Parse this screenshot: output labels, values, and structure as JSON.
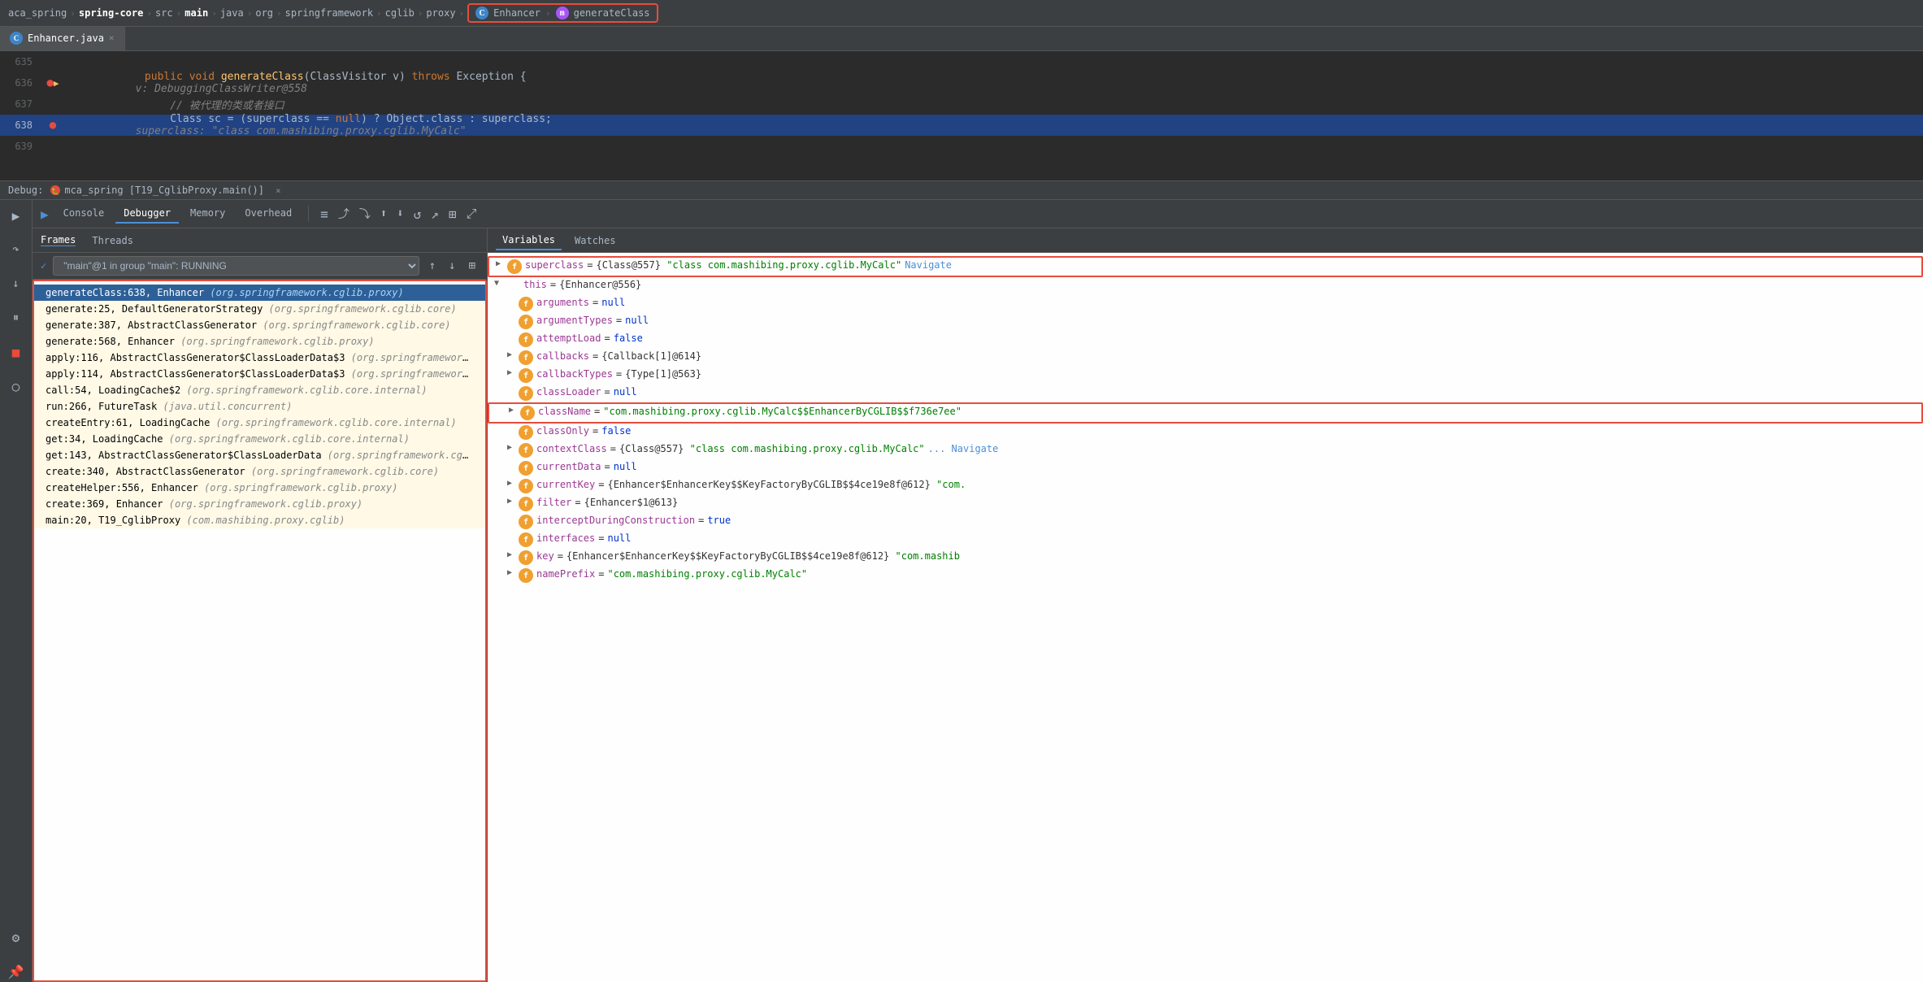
{
  "breadcrumb": {
    "items": [
      "aca_spring",
      "spring-core",
      "src",
      "main",
      "java",
      "org",
      "springframework",
      "cglib",
      "proxy"
    ],
    "highlighted": [
      "Enhancer",
      "generateClass"
    ]
  },
  "tabs": [
    {
      "label": "Enhancer.java",
      "active": true
    }
  ],
  "codeLines": [
    {
      "num": "635",
      "content": "",
      "gutter": ""
    },
    {
      "num": "636",
      "content": "    public void generateClass(ClassVisitor v) throws Exception {",
      "hint": "v: DebuggingClassWriter@558",
      "gutter": "breakpoint,debugarrow"
    },
    {
      "num": "637",
      "content": "        // 被代理的类或者接口",
      "gutter": ""
    },
    {
      "num": "638",
      "content": "        Class sc = (superclass == null) ? Object.class : superclass;",
      "hint": "superclass: \"class com.mashibing.proxy.cglib.MyCalc\"",
      "highlighted": true,
      "gutter": "breakpoint"
    },
    {
      "num": "639",
      "content": "",
      "gutter": ""
    }
  ],
  "debugSession": {
    "label": "Debug:",
    "session": "mca_spring [T19_CglibProxy.main()]"
  },
  "toolbar": {
    "tabs": [
      "Console",
      "Debugger",
      "Memory",
      "Overhead"
    ],
    "activeTab": "Debugger"
  },
  "framesTabs": [
    "Frames",
    "Threads"
  ],
  "activeFramesTab": "Frames",
  "threadSelector": {
    "value": "\"main\"@1 in group \"main\": RUNNING"
  },
  "stackFrames": [
    {
      "method": "generateClass:638, Enhancer",
      "pkg": "(org.springframework.cglib.proxy)",
      "selected": true
    },
    {
      "method": "generate:25, DefaultGeneratorStrategy",
      "pkg": "(org.springframework.cglib.core)",
      "bg": true
    },
    {
      "method": "generate:387, AbstractClassGenerator",
      "pkg": "(org.springframework.cglib.core)",
      "bg": true
    },
    {
      "method": "generate:568, Enhancer",
      "pkg": "(org.springframework.cglib.proxy)",
      "bg": true
    },
    {
      "method": "apply:116, AbstractClassGenerator$ClassLoaderData$3",
      "pkg": "(org.springframework.cglib.",
      "bg": true
    },
    {
      "method": "apply:114, AbstractClassGenerator$ClassLoaderData$3",
      "pkg": "(org.springframework.cglib.",
      "bg": true
    },
    {
      "method": "call:54, LoadingCache$2",
      "pkg": "(org.springframework.cglib.core.internal)",
      "bg": true
    },
    {
      "method": "run:266, FutureTask",
      "pkg": "(java.util.concurrent)",
      "bg": true
    },
    {
      "method": "createEntry:61, LoadingCache",
      "pkg": "(org.springframework.cglib.core.internal)",
      "bg": true
    },
    {
      "method": "get:34, LoadingCache",
      "pkg": "(org.springframework.cglib.core.internal)",
      "bg": true
    },
    {
      "method": "get:143, AbstractClassGenerator$ClassLoaderData",
      "pkg": "(org.springframework.cglib.core",
      "bg": true
    },
    {
      "method": "create:340, AbstractClassGenerator",
      "pkg": "(org.springframework.cglib.core)",
      "bg": true
    },
    {
      "method": "createHelper:556, Enhancer",
      "pkg": "(org.springframework.cglib.proxy)",
      "bg": true
    },
    {
      "method": "create:369, Enhancer",
      "pkg": "(org.springframework.cglib.proxy)",
      "bg": true
    },
    {
      "method": "main:20, T19_CglibProxy",
      "pkg": "(com.mashibing.proxy.cglib)",
      "bg": true
    }
  ],
  "variablesTabs": [
    "Variables",
    "Watches"
  ],
  "activeVarTab": "Variables",
  "variables": [
    {
      "indent": 0,
      "expander": "▶",
      "icon": "f",
      "name": "superclass",
      "eq": "=",
      "val": "{Class@557}",
      "valStr": " \"class com.mashibing.proxy.cglib.MyCalc\"",
      "navigate": "Navigate",
      "highlight": true,
      "superclassRow": true
    },
    {
      "indent": 0,
      "expander": "▼",
      "name": "this",
      "eq": "=",
      "val": "{Enhancer@556}",
      "thisRow": true
    },
    {
      "indent": 1,
      "expander": "",
      "icon": "f",
      "name": "arguments",
      "eq": "=",
      "val": "null"
    },
    {
      "indent": 1,
      "expander": "",
      "icon": "f",
      "name": "argumentTypes",
      "eq": "=",
      "val": "null"
    },
    {
      "indent": 1,
      "expander": "",
      "icon": "f",
      "name": "attemptLoad",
      "eq": "=",
      "val": "false"
    },
    {
      "indent": 1,
      "expander": "▶",
      "icon": "f",
      "name": "callbacks",
      "eq": "=",
      "val": "{Callback[1]@614}"
    },
    {
      "indent": 1,
      "expander": "▶",
      "icon": "f",
      "name": "callbackTypes",
      "eq": "=",
      "val": "{Type[1]@563}"
    },
    {
      "indent": 1,
      "expander": "",
      "icon": "f",
      "name": "classLoader",
      "eq": "=",
      "val": "null"
    },
    {
      "indent": 1,
      "expander": "▶",
      "icon": "f",
      "name": "className",
      "eq": "=",
      "val": "\"com.mashibing.proxy.cglib.MyCalc$$EnhancerByCGLIB$$f736e7ee\"",
      "classNameRow": true
    },
    {
      "indent": 1,
      "expander": "",
      "icon": "f",
      "name": "classOnly",
      "eq": "=",
      "val": "false"
    },
    {
      "indent": 1,
      "expander": "▶",
      "icon": "f",
      "name": "contextClass",
      "eq": "=",
      "val": "{Class@557}",
      "valStr": " \"class com.mashibing.proxy.cglib.MyCalc\"",
      "navigate": "Navigate"
    },
    {
      "indent": 1,
      "expander": "",
      "icon": "f",
      "name": "currentData",
      "eq": "=",
      "val": "null"
    },
    {
      "indent": 1,
      "expander": "▶",
      "icon": "f",
      "name": "currentKey",
      "eq": "=",
      "val": "{Enhancer$EnhancerKey$$KeyFactoryByCGLIB$$4ce19e8f@612}",
      "valStr": " \"com."
    },
    {
      "indent": 1,
      "expander": "▶",
      "icon": "f",
      "name": "filter",
      "eq": "=",
      "val": "{Enhancer$1@613}"
    },
    {
      "indent": 1,
      "expander": "",
      "icon": "f",
      "name": "interceptDuringConstruction",
      "eq": "=",
      "val": "true"
    },
    {
      "indent": 1,
      "expander": "",
      "icon": "f",
      "name": "interfaces",
      "eq": "=",
      "val": "null"
    },
    {
      "indent": 1,
      "expander": "▶",
      "icon": "f",
      "name": "key",
      "eq": "=",
      "val": "{Enhancer$EnhancerKey$$KeyFactoryByCGLIB$$4ce19e8f@612}",
      "valStr": " \"com.mashib"
    },
    {
      "indent": 1,
      "expander": "▶",
      "icon": "f",
      "name": "namePrefix",
      "eq": "=",
      "val": "\"com.mashibing.proxy.cglib.MyCalc\""
    }
  ],
  "icons": {
    "resume": "▶",
    "stepOver": "↷",
    "stepInto": "↓",
    "stepOut": "↑",
    "rerun": "↺",
    "stop": "■",
    "mute": "○",
    "settings": "⚙",
    "up": "↑",
    "down": "↓",
    "filter": "⊞",
    "table": "⊟",
    "restore": "⤢"
  }
}
